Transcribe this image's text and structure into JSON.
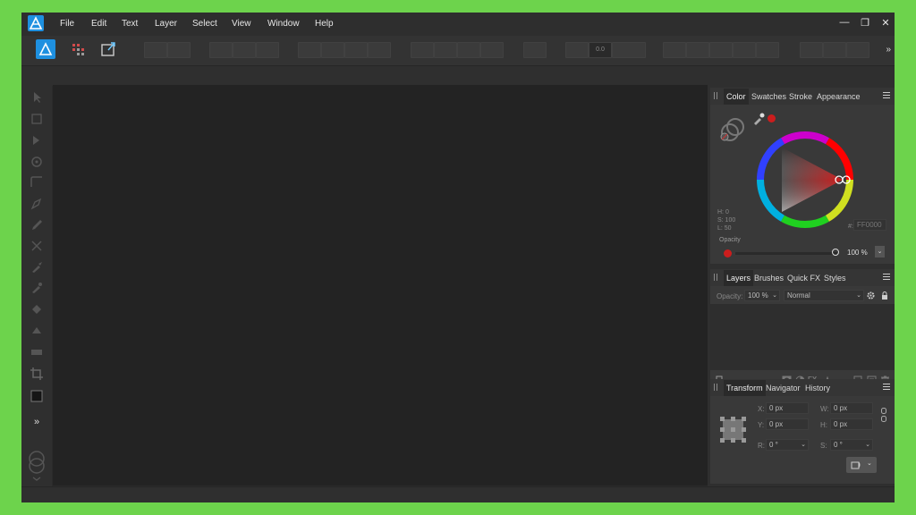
{
  "menu": {
    "items": [
      "File",
      "Edit",
      "Text",
      "Layer",
      "Select",
      "View",
      "Window",
      "Help"
    ]
  },
  "window_controls": {
    "minimize": "—",
    "restore": "❐",
    "close": "✕"
  },
  "toolbar": {
    "more": "»",
    "stroke_width": "0.0"
  },
  "tools": {
    "more": "»"
  },
  "color_panel": {
    "tabs": [
      "Color",
      "Swatches",
      "Stroke",
      "Appearance"
    ],
    "active_tab": "Color",
    "h_label": "H: 0",
    "s_label": "S: 100",
    "l_label": "L: 50",
    "hex_value": "FF0000",
    "hex_prefix": "#:",
    "opacity_label": "Opacity",
    "opacity_value": "100 %",
    "current_color": "#cc1d1d"
  },
  "layers_panel": {
    "tabs": [
      "Layers",
      "Brushes",
      "Quick FX",
      "Styles"
    ],
    "active_tab": "Layers",
    "opacity_label": "Opacity:",
    "opacity_value": "100 %",
    "blend_mode": "Normal"
  },
  "transform_panel": {
    "tabs": [
      "Transform",
      "Navigator",
      "History"
    ],
    "active_tab": "Transform",
    "x_label": "X:",
    "x_value": "0 px",
    "y_label": "Y:",
    "y_value": "0 px",
    "w_label": "W:",
    "w_value": "0 px",
    "h_label": "H:",
    "h_value": "0 px",
    "r_label": "R:",
    "r_value": "0 °",
    "s_label": "S:",
    "s_value": "0 °"
  }
}
